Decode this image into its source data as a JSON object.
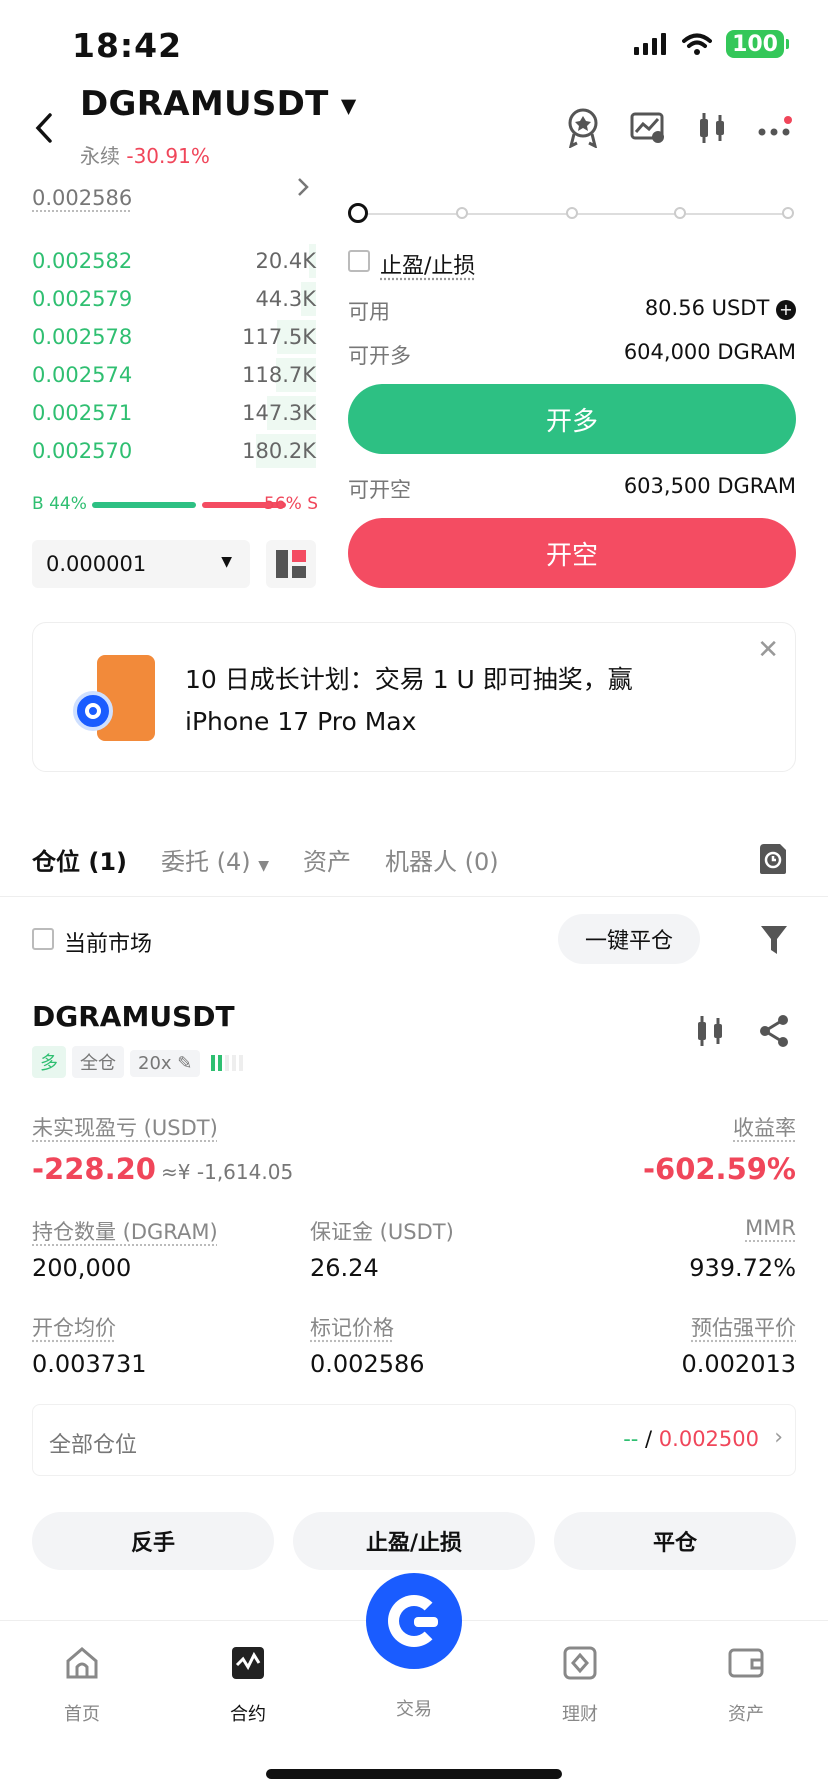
{
  "status": {
    "time": "18:42",
    "battery": "100"
  },
  "header": {
    "symbol": "DGRAMUSDT",
    "type": "永续",
    "change": "-30.91%",
    "back_icon": "chevron-left-icon",
    "dropdown_icon": "caret-down-icon"
  },
  "orderbook": {
    "mark_price": "0.002586",
    "bids": [
      {
        "price": "0.002582",
        "qty": "20.4K"
      },
      {
        "price": "0.002579",
        "qty": "44.3K"
      },
      {
        "price": "0.002578",
        "qty": "117.5K"
      },
      {
        "price": "0.002574",
        "qty": "118.7K"
      },
      {
        "price": "0.002571",
        "qty": "147.3K"
      },
      {
        "price": "0.002570",
        "qty": "180.2K"
      }
    ],
    "buy_ratio": "B 44%",
    "sell_ratio": "56% S",
    "buy_fraction": 0.44,
    "precision": "0.000001"
  },
  "order_form": {
    "tpsl_label": "止盈/止损",
    "available_label": "可用",
    "available_value": "80.56 USDT",
    "can_long_label": "可开多",
    "can_long_value": "604,000 DGRAM",
    "long_button": "开多",
    "can_short_label": "可开空",
    "can_short_value": "603,500 DGRAM",
    "short_button": "开空"
  },
  "banner": {
    "text": "10 日成长计划：交易 1 U 即可抽奖，赢 iPhone 17 Pro Max"
  },
  "tabs": [
    {
      "label": "仓位 (1)"
    },
    {
      "label": "委托 (4)"
    },
    {
      "label": "资产"
    },
    {
      "label": "机器人 (0)"
    }
  ],
  "filter": {
    "current_market": "当前市场",
    "close_all": "一键平仓"
  },
  "position": {
    "symbol": "DGRAMUSDT",
    "side": "多",
    "margin_mode": "全仓",
    "leverage": "20x",
    "unrealized_label": "未实现盈亏 (USDT)",
    "unrealized_value": "-228.20",
    "unrealized_cny": "≈¥ -1,614.05",
    "roi_label": "收益率",
    "roi_value": "-602.59%",
    "size_label": "持仓数量 (DGRAM)",
    "size_value": "200,000",
    "margin_label": "保证金 (USDT)",
    "margin_value": "26.24",
    "mmr_label": "MMR",
    "mmr_value": "939.72%",
    "entry_label": "开仓均价",
    "entry_value": "0.003731",
    "mark_label": "标记价格",
    "mark_value": "0.002586",
    "liq_label": "预估强平价",
    "liq_value": "0.002013",
    "all_label": "全部仓位",
    "all_tp": "--",
    "all_sl": "0.002500",
    "reverse": "反手",
    "tpsl": "止盈/止损",
    "close": "平仓"
  },
  "nav": [
    {
      "label": "首页"
    },
    {
      "label": "合约"
    },
    {
      "label": "交易"
    },
    {
      "label": "理财"
    },
    {
      "label": "资产"
    }
  ],
  "colors": {
    "long": "#2dc083",
    "short": "#f44c62",
    "accent": "#1a5cff"
  }
}
